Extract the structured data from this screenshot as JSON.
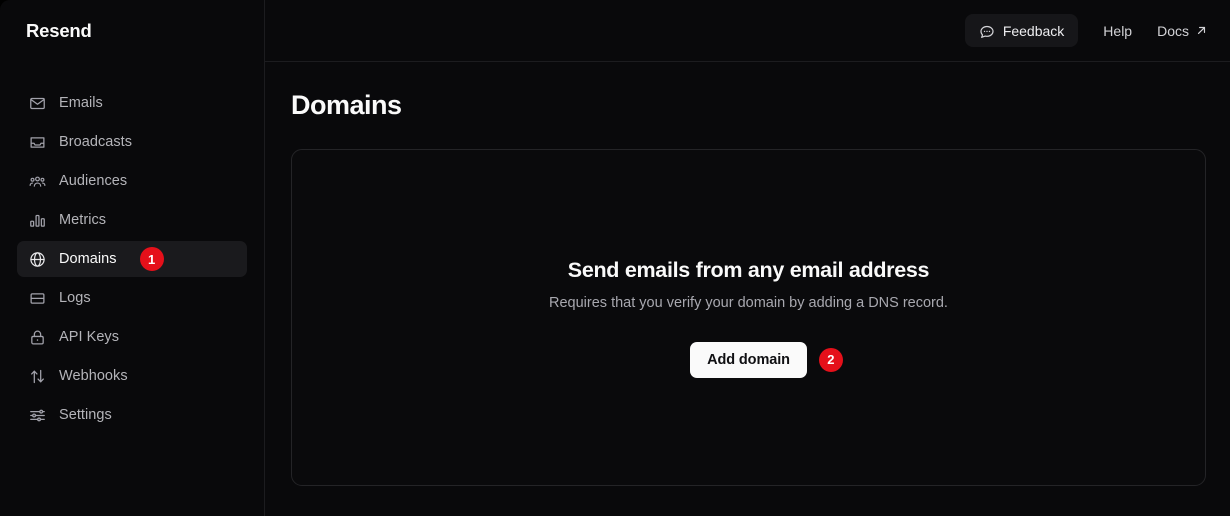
{
  "brand": {
    "name": "Resend"
  },
  "sidebar": {
    "items": [
      {
        "label": "Emails",
        "icon": "envelope-icon",
        "active": false
      },
      {
        "label": "Broadcasts",
        "icon": "inbox-tray-icon",
        "active": false
      },
      {
        "label": "Audiences",
        "icon": "users-group-icon",
        "active": false
      },
      {
        "label": "Metrics",
        "icon": "bar-chart-icon",
        "active": false
      },
      {
        "label": "Domains",
        "icon": "globe-icon",
        "active": true,
        "marker": "1"
      },
      {
        "label": "Logs",
        "icon": "logs-icon",
        "active": false
      },
      {
        "label": "API Keys",
        "icon": "lock-icon",
        "active": false
      },
      {
        "label": "Webhooks",
        "icon": "arrows-up-down-icon",
        "active": false
      },
      {
        "label": "Settings",
        "icon": "sliders-icon",
        "active": false
      }
    ]
  },
  "topbar": {
    "feedback_label": "Feedback",
    "feedback_icon": "chat-bubble-dots-icon",
    "help_label": "Help",
    "docs_label": "Docs",
    "docs_icon": "external-link-arrow-icon"
  },
  "main": {
    "page_title": "Domains",
    "empty_state": {
      "title": "Send emails from any email address",
      "description": "Requires that you verify your domain by adding a DNS record.",
      "cta_label": "Add domain",
      "cta_marker": "2"
    }
  },
  "colors": {
    "background": "#09090b",
    "sidebar_active": "#1a1a1d",
    "border": "#242427",
    "marker_red": "#e5101a",
    "cta_background": "#fafafa",
    "text_primary": "#fafafa",
    "text_muted": "#a8a8af"
  }
}
